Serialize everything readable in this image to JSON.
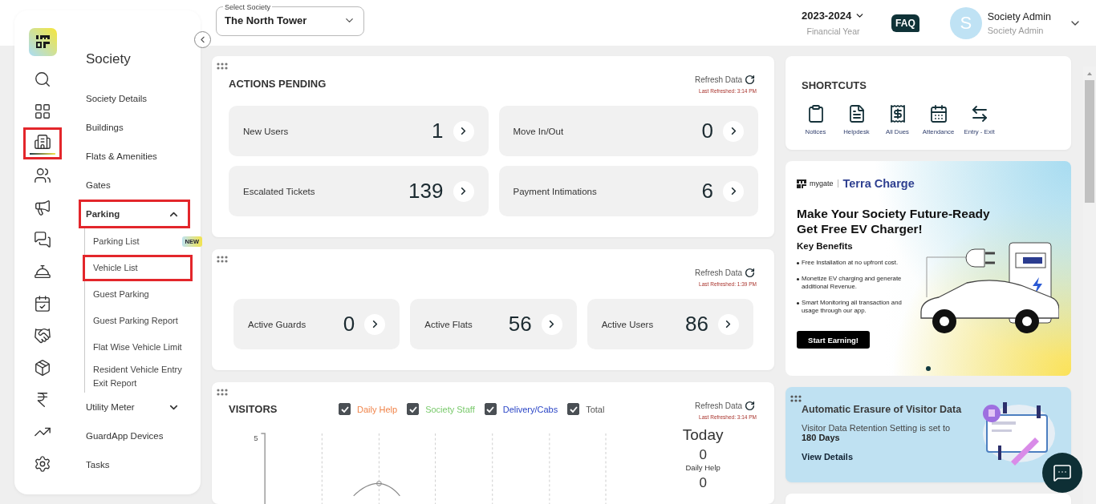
{
  "header": {
    "society_select": {
      "label": "Select Society",
      "value": "The North Tower"
    },
    "financial_year": {
      "value": "2023-2024",
      "caption": "Financial Year"
    },
    "faq": "FAQ",
    "user": {
      "initial": "S",
      "name": "Society Admin",
      "role": "Society Admin"
    }
  },
  "sidebar": {
    "rail": [
      {
        "kind": "search",
        "selected": false,
        "highlighted": false
      },
      {
        "kind": "dashboard",
        "selected": false,
        "highlighted": false
      },
      {
        "kind": "building",
        "selected": true,
        "highlighted": true
      },
      {
        "kind": "people",
        "selected": false,
        "highlighted": false
      },
      {
        "kind": "megaphone",
        "selected": false,
        "highlighted": false
      },
      {
        "kind": "chat",
        "selected": false,
        "highlighted": false
      },
      {
        "kind": "desk",
        "selected": false,
        "highlighted": false
      },
      {
        "kind": "calendar",
        "selected": false,
        "highlighted": false
      },
      {
        "kind": "handshake",
        "selected": false,
        "highlighted": false
      },
      {
        "kind": "box",
        "selected": false,
        "highlighted": false
      },
      {
        "kind": "rupee",
        "selected": false,
        "highlighted": false
      },
      {
        "kind": "report",
        "selected": false,
        "highlighted": false
      },
      {
        "kind": "settings",
        "selected": false,
        "highlighted": false
      }
    ],
    "title": "Society",
    "items": [
      {
        "kind": "link",
        "label": "Society Details",
        "highlighted": false
      },
      {
        "kind": "link",
        "label": "Buildings",
        "highlighted": false
      },
      {
        "kind": "link",
        "label": "Flats & Amenities",
        "highlighted": false
      },
      {
        "kind": "link",
        "label": "Gates",
        "highlighted": false
      },
      {
        "kind": "group",
        "label": "Parking",
        "expanded": true,
        "highlighted": true,
        "children": [
          {
            "label": "Parking List",
            "highlighted": false,
            "badge": "NEW"
          },
          {
            "label": "Vehicle List",
            "highlighted": true
          },
          {
            "label": "Guest Parking",
            "highlighted": false
          },
          {
            "label": "Guest Parking Report",
            "highlighted": false
          },
          {
            "label": "Flat Wise Vehicle Limit",
            "highlighted": false
          },
          {
            "label": "Resident Vehicle Entry Exit Report",
            "highlighted": false
          }
        ]
      },
      {
        "kind": "group",
        "label": "Utility Meter",
        "expanded": false,
        "highlighted": false
      },
      {
        "kind": "link",
        "label": "GuardApp Devices",
        "highlighted": false
      },
      {
        "kind": "link",
        "label": "Tasks",
        "highlighted": false
      }
    ]
  },
  "actions_pending": {
    "title": "ACTIONS PENDING",
    "refresh": {
      "label": "Refresh Data",
      "last": "Last Refreshed: 3:14 PM"
    },
    "tiles": [
      {
        "label": "New Users",
        "count": "1"
      },
      {
        "label": "Move In/Out",
        "count": "0"
      },
      {
        "label": "Escalated Tickets",
        "count": "139"
      },
      {
        "label": "Payment Intimations",
        "count": "6"
      }
    ]
  },
  "activity": {
    "refresh": {
      "label": "Refresh Data",
      "last": "Last Refreshed: 1:39 PM"
    },
    "tiles": [
      {
        "label": "Active Guards",
        "count": "0"
      },
      {
        "label": "Active Flats",
        "count": "56"
      },
      {
        "label": "Active Users",
        "count": "86"
      }
    ]
  },
  "visitors": {
    "title": "VISITORS",
    "legend": [
      {
        "label": "Daily Help",
        "color": "#f0844a",
        "checked": true
      },
      {
        "label": "Society Staff",
        "color": "#78c96a",
        "checked": true
      },
      {
        "label": "Delivery/Cabs",
        "color": "#2a45c6",
        "checked": true
      },
      {
        "label": "Total",
        "color": "#555555",
        "checked": true
      }
    ],
    "refresh": {
      "label": "Refresh Data",
      "last": "Last Refreshed: 3:14 PM"
    },
    "y_tick": "5",
    "today": {
      "title": "Today",
      "stats": [
        {
          "count": "0",
          "label": "Daily Help"
        },
        {
          "count": "0"
        }
      ]
    }
  },
  "shortcuts": {
    "title": "SHORTCUTS",
    "items": [
      {
        "kind": "notices",
        "label": "Notices"
      },
      {
        "kind": "helpdesk",
        "label": "Helpdesk"
      },
      {
        "kind": "dues",
        "label": "All Dues"
      },
      {
        "kind": "attendance",
        "label": "Attendance"
      },
      {
        "kind": "entry_exit",
        "label": "Entry - Exit"
      }
    ]
  },
  "promo": {
    "brand": "mygate",
    "product": "Terra Charge",
    "headline": [
      "Make Your Society Future-Ready",
      "Get Free EV Charger!"
    ],
    "benefits_title": "Key Benefits",
    "benefits": [
      "Free Installation at no upfront cost.",
      "Monetize EV charging and generate additional Revenue.",
      "Smart Monitoring all transaction and usage through our app."
    ],
    "cta": "Start Earning!",
    "dots": [
      {
        "selected": true
      }
    ]
  },
  "erasure": {
    "title": "Automatic Erasure of Visitor Data",
    "text": "Visitor Data Retention Setting is set to **180 Days**",
    "link": "View Details"
  }
}
